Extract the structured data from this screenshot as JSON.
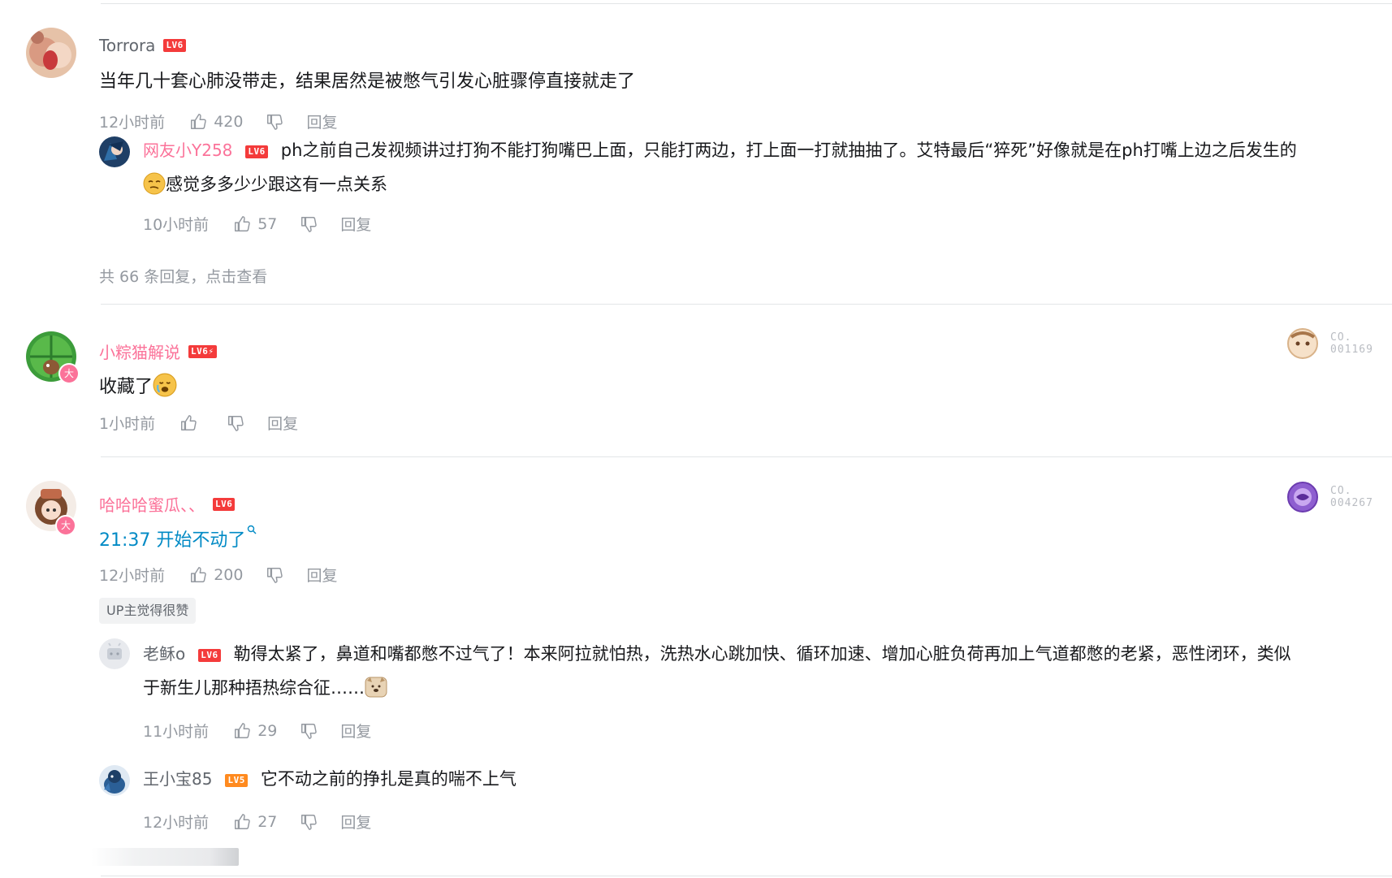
{
  "comments": [
    {
      "username": "Torrora",
      "level": "LV6",
      "content": "当年几十套心肺没带走，结果居然是被憋气引发心脏骤停直接就走了",
      "time": "12小时前",
      "likes": "420",
      "reply_label": "回复",
      "replies": [
        {
          "username": "网友小Y258",
          "level": "LV6",
          "content_part1": "ph之前自己发视频讲过打狗不能打狗嘴巴上面，只能打两边，打上面一打就抽抽了。艾特最后“猝死”好像就是在ph打嘴上边之后发生的",
          "content_part2": "感觉多多少少跟这有一点关系",
          "emoji": "doge-face-icon",
          "time": "10小时前",
          "likes": "57",
          "reply_label": "回复"
        }
      ],
      "view_more": "共 66 条回复，点击查看"
    },
    {
      "username": "小粽猫解说",
      "level": "LV6⚡",
      "content": "收藏了",
      "emoji": "crying-face-icon",
      "time": "1小时前",
      "likes": "",
      "reply_label": "回复",
      "fan_badge": {
        "line1": "CO.",
        "line2": "001169",
        "icon": "fan-badge-avatar-icon"
      }
    },
    {
      "username": "哈哈哈蜜瓜、、",
      "level": "LV6",
      "content": "21:37 开始不动了",
      "time": "12小时前",
      "likes": "200",
      "reply_label": "回复",
      "up_tag": "UP主觉得很赞",
      "fan_badge": {
        "line1": "CO.",
        "line2": "004267",
        "icon": "fan-badge-purple-icon"
      },
      "replies": [
        {
          "username": "老稣o",
          "level": "LV6",
          "content_part1": "勒得太紧了，鼻道和嘴都憋不过气了！本来阿拉就怕热，洗热水心跳加快、循环加速、增加心脏负荷再加上气道都憋的老紧，恶性闭环，类似",
          "content_part2": "于新生儿那种捂热综合征……",
          "emoji": "dog-face-icon",
          "time": "11小时前",
          "likes": "29",
          "reply_label": "回复"
        },
        {
          "username": "王小宝85",
          "level": "LV5",
          "content_part1": "它不动之前的挣扎是真的喘不上气",
          "time": "12小时前",
          "likes": "27",
          "reply_label": "回复"
        }
      ]
    }
  ],
  "colors": {
    "vip_pink": "#fb7299",
    "link_blue": "#008ac5",
    "meta_gray": "#9499a0",
    "level_red": "#f43b3b",
    "level_orange": "#ff8a1f"
  }
}
